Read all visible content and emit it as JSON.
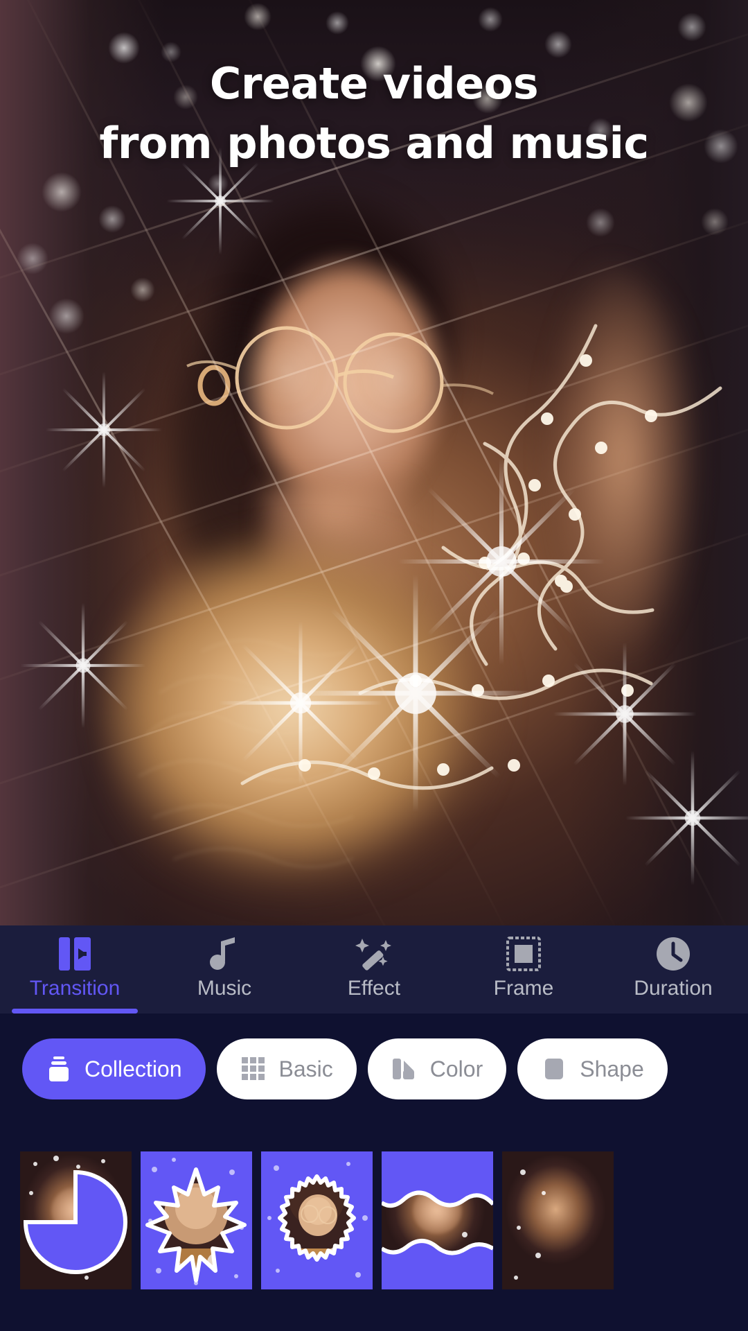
{
  "headline": {
    "line1": "Create videos",
    "line2": "from photos and music"
  },
  "preview": {
    "description": "Woman with round glasses holding glowing string lights, bokeh background"
  },
  "toolbar": {
    "tabs": [
      {
        "label": "Transition",
        "icon": "transition-icon",
        "active": true
      },
      {
        "label": "Music",
        "icon": "music-note-icon",
        "active": false
      },
      {
        "label": "Effect",
        "icon": "magic-wand-icon",
        "active": false
      },
      {
        "label": "Frame",
        "icon": "frame-icon",
        "active": false
      },
      {
        "label": "Duration",
        "icon": "clock-icon",
        "active": false
      }
    ]
  },
  "filters": {
    "chips": [
      {
        "label": "Collection",
        "icon": "layers-icon",
        "active": true
      },
      {
        "label": "Basic",
        "icon": "grid-icon",
        "active": false
      },
      {
        "label": "Color",
        "icon": "palette-icon",
        "active": false
      },
      {
        "label": "Shape",
        "icon": "square-icon",
        "active": false
      }
    ]
  },
  "transitions": {
    "items": [
      {
        "name": "pie-wipe",
        "style": "pie"
      },
      {
        "name": "maple-leaf-mask",
        "style": "leaf"
      },
      {
        "name": "zigzag-circle-mask",
        "style": "zigzag"
      },
      {
        "name": "wave-wipe",
        "style": "wave"
      },
      {
        "name": "photo-partial",
        "style": "plain"
      }
    ]
  },
  "colors": {
    "accent": "#6257f5",
    "toolbar_bg": "#1b1d3d",
    "panel_bg": "#0f1130",
    "chip_bg": "#ffffff",
    "chip_text": "#8b8d95",
    "tab_text": "#b9bcc6"
  }
}
